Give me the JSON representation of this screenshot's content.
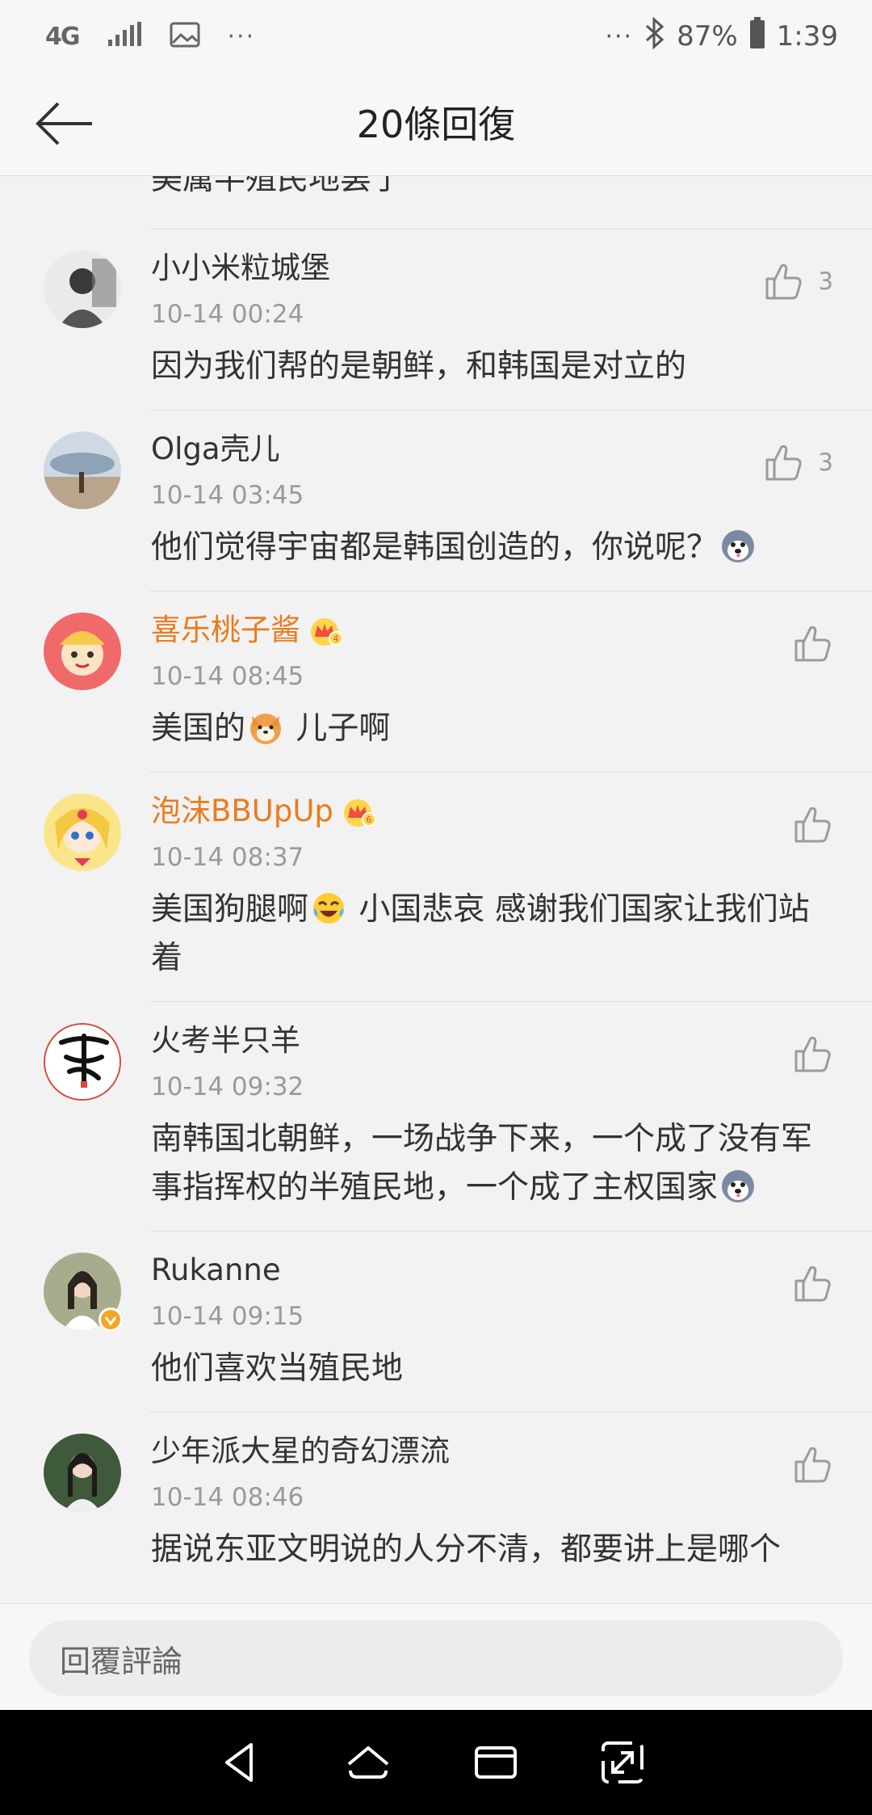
{
  "status_bar": {
    "network": "4G",
    "more_left": "···",
    "more_right": "···",
    "battery": "87%",
    "time": "1:39"
  },
  "header": {
    "title": "20條回復"
  },
  "partial_comment": {
    "text": "美属半殖民地罢了"
  },
  "comments": [
    {
      "name": "小小米粒城堡",
      "time": "10-14 00:24",
      "text": "因为我们帮的是朝鲜，和韩国是对立的",
      "likes": "3",
      "avatar_color": "#5a5a5a"
    },
    {
      "name": "Olga壳儿",
      "time": "10-14 03:45",
      "text": "他们觉得宇宙都是韩国创造的，你说呢？",
      "likes": "3",
      "avatar_color": "#8aa0b8"
    },
    {
      "name": "喜乐桃子酱",
      "time": "10-14 08:45",
      "text_a": "美国的",
      "text_b": " 儿子啊",
      "likes": "",
      "vip_level": "4",
      "avatar_color": "#e85a5a"
    },
    {
      "name": "泡沫BBUpUp",
      "time": "10-14 08:37",
      "text_a": "美国狗腿啊",
      "text_b": " 小国悲哀 感谢我们国家让我们站着",
      "likes": "",
      "vip_level": "6",
      "avatar_color": "#f3d36b"
    },
    {
      "name": "火考半只羊",
      "time": "10-14 09:32",
      "text": "南韩国北朝鲜，一场战争下来，一个成了没有军事指挥权的半殖民地，一个成了主权国家",
      "likes": "",
      "avatar_color": "#ffffff"
    },
    {
      "name": "Rukanne",
      "time": "10-14 09:15",
      "text": "他们喜欢当殖民地",
      "likes": "",
      "verified": true,
      "avatar_color": "#6b7a5a"
    },
    {
      "name": "少年派大星的奇幻漂流",
      "time": "10-14 08:46",
      "text": "据说东亚文明说的人分不清，都要讲上是哪个",
      "likes": "",
      "avatar_color": "#4f6b47"
    }
  ],
  "reply_input": {
    "placeholder": "回覆評論"
  },
  "colors": {
    "vip_name": "#ea7b1e",
    "background": "#f2f2f2",
    "divider": "#dcdcdc",
    "meta_gray": "#9a9a9a"
  },
  "icons": {
    "back": "arrow-left-icon",
    "like": "thumbs-up-icon",
    "vip": "crown-icon",
    "nav_back": "triangle-back-icon",
    "nav_home": "home-icon",
    "nav_recents": "recents-icon",
    "nav_expand": "expand-icon"
  }
}
